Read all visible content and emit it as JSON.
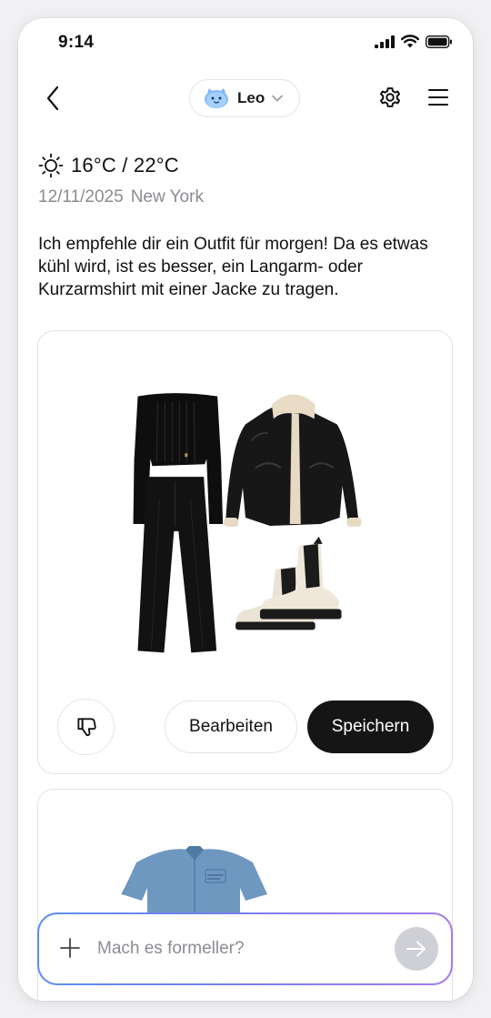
{
  "status_bar": {
    "time": "9:14"
  },
  "header": {
    "agent_name": "Leo"
  },
  "weather": {
    "temperature": "16°C / 22°C",
    "date": "12/11/2025",
    "location": "New York"
  },
  "assistant_message": "Ich empfehle dir ein Outfit für morgen! Da es etwas kühl wird, ist es besser, ein Langarm- oder Kurzarmshirt mit einer Jacke zu tragen.",
  "outfit_card": {
    "items": [
      "black-off-shoulder-knit-top",
      "black-flared-trousers",
      "black-shearling-leather-jacket",
      "cream-chelsea-boots"
    ],
    "edit_label": "Bearbeiten",
    "save_label": "Speichern"
  },
  "outfit_card_2": {
    "items": [
      "denim-short-sleeve-shirt"
    ]
  },
  "chat_input": {
    "placeholder": "Mach es formeller?",
    "value": ""
  },
  "colors": {
    "accent_dark": "#151515",
    "gradient_start": "#5b8ff2",
    "gradient_end": "#a47cf0",
    "muted_text": "#8b8b92"
  }
}
